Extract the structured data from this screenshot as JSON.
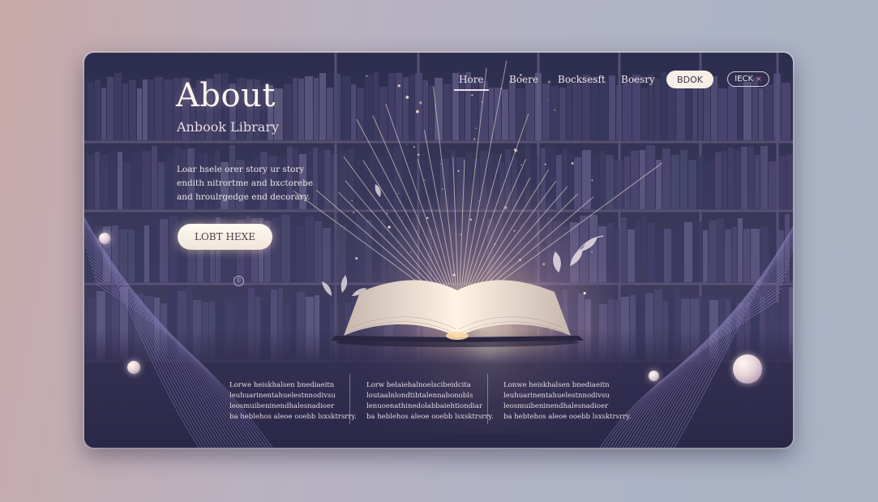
{
  "nav": {
    "links": [
      "Hore",
      "Boere",
      "Bocksesft",
      "Boesry"
    ],
    "pill_label": "BDOK",
    "outline_label": "IECK",
    "outline_mark": "×"
  },
  "hero": {
    "title": "About",
    "subtitle": "Anbook Library",
    "description_lines": [
      "Loar hsele orer story ur story",
      "endith nitrortme and bxctorebe",
      "and hroulrgedge end decorary."
    ],
    "cta_label": "LOBT HEXE",
    "small_icon": "©"
  },
  "columns": [
    {
      "lines": [
        "Lorwe heiskhalsen bnediaeitn",
        "leuhuarinentahuelestnnodivsu",
        "leosmuibeninendhalesnadioer",
        "ba heblehos aleoe ooebb lsxsktrsrry."
      ]
    },
    {
      "lines": [
        "Lorw belaiehalnoelscibeidcita",
        "loutaalnlondtibtalennabonobls",
        "lenuoenathinedolabbaiehtiondiar",
        "ba heblehos aleoe ooebb lsxsktrsrry."
      ]
    },
    {
      "lines": [
        "Lonwe heiskhalsen bnediaeitn",
        "leuhuarinentahuelestnnodivsu",
        "leosmuibeninendhalesnadioer",
        "ba hebtehos aleoe ooebb lsxsktrsrry."
      ]
    }
  ],
  "colors": {
    "accent_glow": "#ffe8d2",
    "card_bg": "#2d2e4f",
    "pill_bg": "#f7efe6",
    "outline_mark": "#e58ca4"
  },
  "icons": [
    "sparkle-icon",
    "leaf-icon",
    "open-book-icon",
    "circle-c-icon",
    "orb-icon"
  ]
}
